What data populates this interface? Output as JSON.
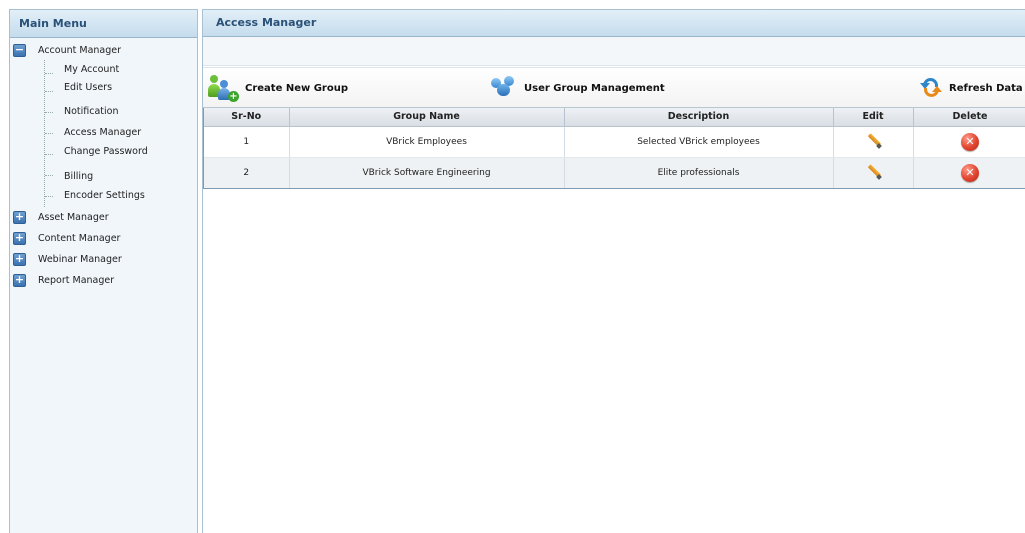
{
  "sidebar": {
    "title": "Main Menu",
    "account_manager": {
      "label": "Account Manager",
      "toggle": "−",
      "children": [
        "My Account",
        "Edit Users",
        "Notification",
        "Access Manager",
        "Change Password",
        "Billing",
        "Encoder Settings"
      ]
    },
    "collapsed": [
      {
        "label": "Asset Manager",
        "toggle": "+"
      },
      {
        "label": "Content Manager",
        "toggle": "+"
      },
      {
        "label": "Webinar Manager",
        "toggle": "+"
      },
      {
        "label": "Report Manager",
        "toggle": "+"
      }
    ]
  },
  "main": {
    "title": "Access Manager",
    "toolbar": {
      "create_group": "Create New Group",
      "user_group_management": "User Group Management",
      "refresh": "Refresh Data"
    },
    "table": {
      "headers": [
        "Sr-No",
        "Group Name",
        "Description",
        "Edit",
        "Delete"
      ],
      "rows": [
        {
          "sr": "1",
          "group_name": "VBrick Employees",
          "description": "Selected VBrick employees"
        },
        {
          "sr": "2",
          "group_name": "VBrick Software Engineering",
          "description": "Elite professionals"
        }
      ],
      "delete_glyph": "✕"
    }
  },
  "icons": {
    "tree_toggle": "square-plus-minus-icon",
    "edit": "pencil-icon",
    "delete": "red-x-circle-icon",
    "create_group": "add-group-icon",
    "user_group": "users-icon",
    "refresh": "refresh-arrows-icon"
  },
  "colors": {
    "header_text": "#2a5178",
    "sidebar_bg": "#f0f6fa",
    "toggle_blue": "#3b72b0",
    "delete_red": "#e0442e",
    "refresh_blue": "#2f86c9",
    "refresh_orange": "#e88a1a"
  }
}
